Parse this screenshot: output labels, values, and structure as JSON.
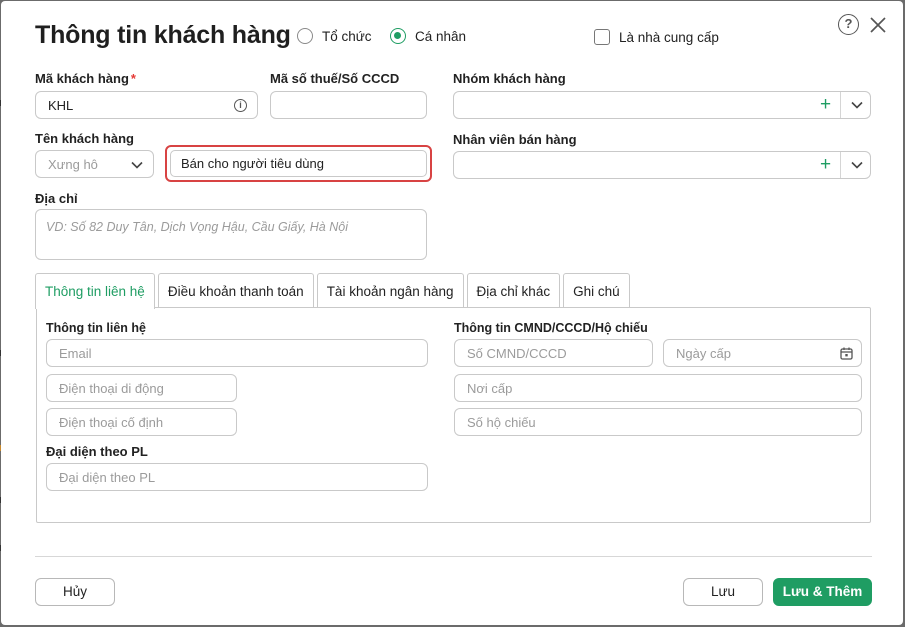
{
  "dialog": {
    "title": "Thông tin khách hàng",
    "type_options": [
      {
        "label": "Tổ chức",
        "selected": false
      },
      {
        "label": "Cá nhân",
        "selected": true
      }
    ],
    "supplier_checkbox": {
      "label": "Là nhà cung cấp",
      "checked": false
    },
    "help_label": "?"
  },
  "form": {
    "customer_code": {
      "label": "Mã khách hàng",
      "required_mark": "*",
      "value": "KHL",
      "info_glyph": "i"
    },
    "tax_code": {
      "label": "Mã số thuế/Số CCCD",
      "value": ""
    },
    "customer_group": {
      "label": "Nhóm khách hàng",
      "value": "",
      "add_glyph": "+"
    },
    "customer_name": {
      "label": "Tên khách hàng",
      "salutation_placeholder": "Xưng hô",
      "value": "Bán cho người tiêu dùng"
    },
    "sales_staff": {
      "label": "Nhân viên bán hàng",
      "value": "",
      "add_glyph": "+"
    },
    "address": {
      "label": "Địa chỉ",
      "placeholder": "VD: Số 82 Duy Tân, Dịch Vọng Hậu, Cầu Giấy, Hà Nội"
    }
  },
  "tabs": [
    {
      "label": "Thông tin liên hệ",
      "active": true
    },
    {
      "label": "Điều khoản thanh toán",
      "active": false
    },
    {
      "label": "Tài khoản ngân hàng",
      "active": false
    },
    {
      "label": "Địa chỉ khác",
      "active": false
    },
    {
      "label": "Ghi chú",
      "active": false
    }
  ],
  "contact": {
    "section_title": "Thông tin liên hệ",
    "email_placeholder": "Email",
    "mobile_placeholder": "Điện thoại di động",
    "landline_placeholder": "Điện thoại cố định",
    "legal_rep_title": "Đại diện theo PL",
    "legal_rep_placeholder": "Đại diện theo PL"
  },
  "id_card": {
    "section_title": "Thông tin CMND/CCCD/Hộ chiếu",
    "number_placeholder": "Số CMND/CCCD",
    "issue_date_placeholder": "Ngày cấp",
    "issue_place_placeholder": "Nơi cấp",
    "passport_placeholder": "Số hộ chiếu"
  },
  "footer": {
    "cancel_label": "Hủy",
    "save_label": "Lưu",
    "save_add_label": "Lưu & Thêm"
  },
  "colors": {
    "accent": "#1f9d63",
    "error_border": "#d84343",
    "required": "#e53935"
  },
  "icons": [
    "help-icon",
    "close-icon",
    "info-icon",
    "plus-icon",
    "chevron-down-icon",
    "calendar-icon"
  ]
}
